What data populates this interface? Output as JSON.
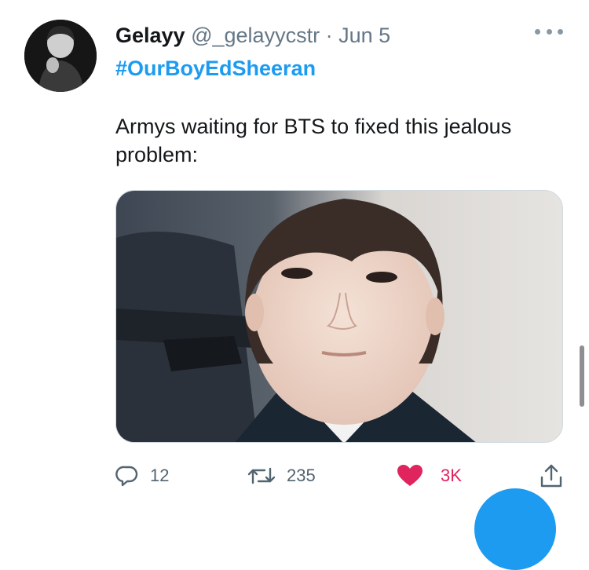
{
  "tweet": {
    "author_name": "Gelayy",
    "handle": "@_gelayycstr",
    "separator": "·",
    "date": "Jun 5",
    "hashtag": "#OurBoyEdSheeran",
    "text": "Armys waiting for BTS to fixed this jealous problem:"
  },
  "actions": {
    "replies": "12",
    "retweets": "235",
    "likes": "3K",
    "liked": true
  },
  "icons": {
    "more": "more-horizontal-icon",
    "reply": "reply-icon",
    "retweet": "retweet-icon",
    "like": "heart-icon",
    "share": "share-icon"
  },
  "colors": {
    "accent": "#1d9bf0",
    "like_active": "#e0245e",
    "secondary_text": "#657786"
  }
}
